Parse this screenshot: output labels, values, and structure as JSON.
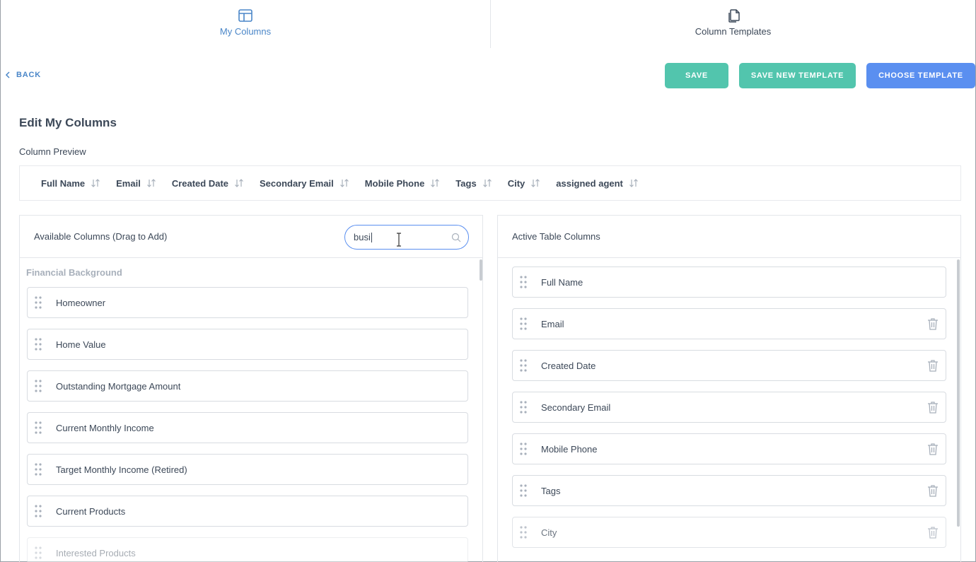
{
  "tabs": [
    {
      "label": "My Columns",
      "icon": "layout-icon",
      "active": true
    },
    {
      "label": "Column Templates",
      "icon": "copy-icon",
      "active": false
    }
  ],
  "toolbar": {
    "back_label": "BACK",
    "save_label": "SAVE",
    "save_new_template_label": "SAVE NEW TEMPLATE",
    "choose_template_label": "CHOOSE TEMPLATE"
  },
  "page": {
    "title": "Edit My Columns",
    "preview_label": "Column Preview"
  },
  "preview_columns": [
    "Full Name",
    "Email",
    "Created Date",
    "Secondary Email",
    "Mobile Phone",
    "Tags",
    "City",
    "assigned agent"
  ],
  "available": {
    "title": "Available Columns (Drag to Add)",
    "search_value": "busi",
    "group_label": "Financial Background",
    "items": [
      "Homeowner",
      "Home Value",
      "Outstanding Mortgage Amount",
      "Current Monthly Income",
      "Target Monthly Income (Retired)",
      "Current Products",
      "Interested Products"
    ]
  },
  "active": {
    "title": "Active Table Columns",
    "items": [
      "Full Name",
      "Email",
      "Created Date",
      "Secondary Email",
      "Mobile Phone",
      "Tags",
      "City"
    ]
  },
  "colors": {
    "accent_blue": "#5a8ff0",
    "teal": "#52c5ad",
    "link_blue": "#4a86c8",
    "text": "#3c4858"
  }
}
